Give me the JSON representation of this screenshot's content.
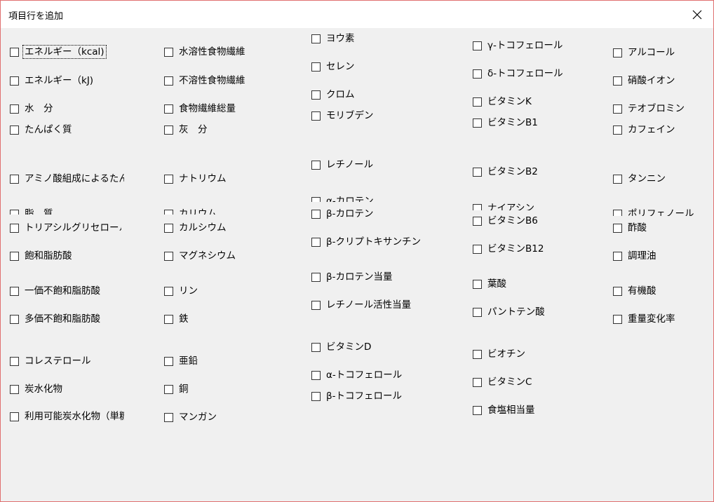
{
  "window": {
    "title": "項目行を追加",
    "close_icon": "close-icon"
  },
  "checkboxes": {
    "c1": [
      "エネルギー（kcal)",
      "エネルギー（kJ)",
      "水　分",
      "たんぱく質",
      "アミノ酸組成によるたんぱく質",
      "脂　質",
      "トリアシルグリセロール当量",
      "飽和脂肪酸",
      "一価不飽和脂肪酸",
      "多価不飽和脂肪酸",
      "コレステロール",
      "炭水化物",
      "利用可能炭水化物（単糖当量）"
    ],
    "c2": [
      "水溶性食物繊維",
      "不溶性食物繊維",
      "食物繊維総量",
      "灰　分",
      "ナトリウム",
      "カリウム",
      "カルシウム",
      "マグネシウム",
      "リン",
      "鉄",
      "亜鉛",
      "銅",
      "マンガン"
    ],
    "c3": [
      "ヨウ素",
      "セレン",
      "クロム",
      "モリブデン",
      "レチノール",
      "α-カロテン",
      "β-カロテン",
      "β-クリプトキサンチン",
      "β-カロテン当量",
      "レチノール活性当量",
      "ビタミンD",
      "α-トコフェロール",
      "β-トコフェロール"
    ],
    "c4": [
      "γ-トコフェロール",
      "δ-トコフェロール",
      "ビタミンK",
      "ビタミンB1",
      "ビタミンB2",
      "ナイアシン",
      "ビタミンB6",
      "ビタミンB12",
      "葉酸",
      "パントテン酸",
      "ビオチン",
      "ビタミンC",
      "食塩相当量"
    ],
    "c5": [
      "アルコール",
      "硝酸イオン",
      "テオブロミン",
      "カフェイン",
      "タンニン",
      "ポリフェノール",
      "酢酸",
      "調理油",
      "有機酸",
      "重量変化率"
    ]
  }
}
